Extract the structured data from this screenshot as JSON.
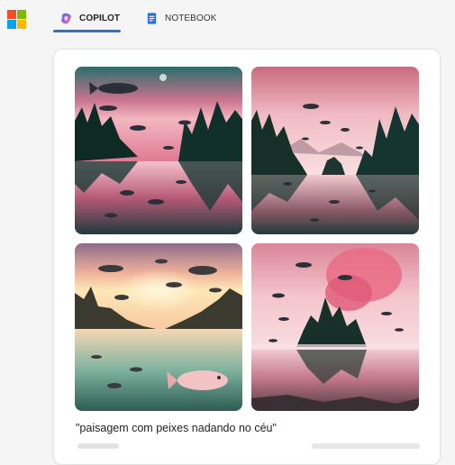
{
  "header": {
    "tabs": [
      {
        "label": "COPILOT",
        "active": true
      },
      {
        "label": "NOTEBOOK",
        "active": false
      }
    ]
  },
  "colors": {
    "accent": "#2f6fdc",
    "ms_red": "#f25022",
    "ms_green": "#7fba00",
    "ms_blue": "#00a4ef",
    "ms_yellow": "#ffb900"
  },
  "result": {
    "prompt": "\"paisagem com peixes nadando no céu\"",
    "images": [
      {
        "name": "generated-image-1"
      },
      {
        "name": "generated-image-2"
      },
      {
        "name": "generated-image-3"
      },
      {
        "name": "generated-image-4"
      }
    ]
  }
}
